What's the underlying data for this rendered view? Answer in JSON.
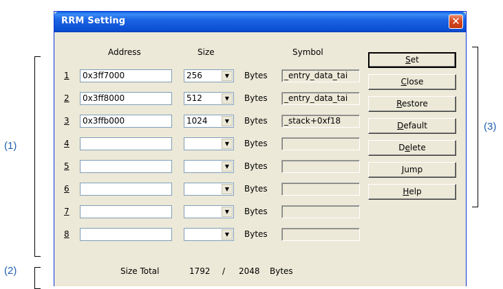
{
  "annotations": {
    "left_rows": "(1)",
    "left_total": "(2)",
    "right_buttons": "(3)"
  },
  "window": {
    "title": "RRM Setting",
    "close_glyph": "✕"
  },
  "headers": {
    "address": "Address",
    "size": "Size",
    "symbol": "Symbol"
  },
  "rows": [
    {
      "num": "1",
      "address": "0x3ff7000",
      "size": "256",
      "unit": "Bytes",
      "symbol": "_entry_data_tai"
    },
    {
      "num": "2",
      "address": "0x3ff8000",
      "size": "512",
      "unit": "Bytes",
      "symbol": "_entry_data_tai"
    },
    {
      "num": "3",
      "address": "0x3ffb000",
      "size": "1024",
      "unit": "Bytes",
      "symbol": "_stack+0xf18"
    },
    {
      "num": "4",
      "address": "",
      "size": "",
      "unit": "Bytes",
      "symbol": ""
    },
    {
      "num": "5",
      "address": "",
      "size": "",
      "unit": "Bytes",
      "symbol": ""
    },
    {
      "num": "6",
      "address": "",
      "size": "",
      "unit": "Bytes",
      "symbol": ""
    },
    {
      "num": "7",
      "address": "",
      "size": "",
      "unit": "Bytes",
      "symbol": ""
    },
    {
      "num": "8",
      "address": "",
      "size": "",
      "unit": "Bytes",
      "symbol": ""
    }
  ],
  "buttons": [
    {
      "pre": "",
      "acc": "S",
      "post": "et"
    },
    {
      "pre": "",
      "acc": "C",
      "post": "lose"
    },
    {
      "pre": "",
      "acc": "R",
      "post": "estore"
    },
    {
      "pre": "",
      "acc": "D",
      "post": "efault"
    },
    {
      "pre": "D",
      "acc": "e",
      "post": "lete"
    },
    {
      "pre": "",
      "acc": "J",
      "post": "ump"
    },
    {
      "pre": "",
      "acc": "H",
      "post": "elp"
    }
  ],
  "size_total": {
    "label": "Size Total",
    "used": "1792",
    "sep": "/",
    "max": "2048",
    "unit": "Bytes"
  },
  "icons": {
    "dropdown": "dropdown-arrow-icon",
    "close": "close-icon"
  }
}
